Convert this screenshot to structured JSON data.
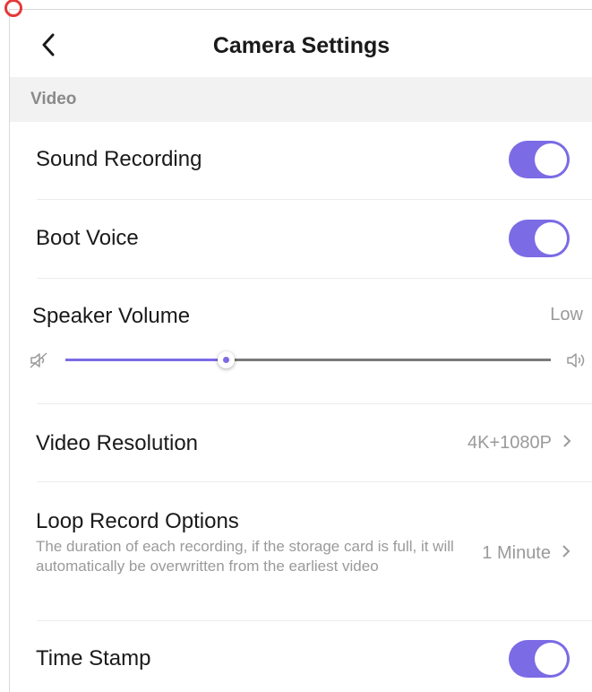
{
  "header": {
    "title": "Camera Settings",
    "back_icon": "chevron-left-icon"
  },
  "section": {
    "label": "Video"
  },
  "rows": {
    "sound_recording": {
      "label": "Sound Recording",
      "enabled": true
    },
    "boot_voice": {
      "label": "Boot Voice",
      "enabled": true
    },
    "speaker_volume": {
      "label": "Speaker Volume",
      "value": "Low",
      "level_fraction": 0.33
    },
    "video_resolution": {
      "label": "Video Resolution",
      "value": "4K+1080P"
    },
    "loop_record": {
      "label": "Loop Record Options",
      "description": "The duration of each recording, if the storage card is full, it will automatically be overwritten from the earliest video",
      "value": "1 Minute"
    },
    "time_stamp": {
      "label": "Time Stamp",
      "enabled": true
    }
  },
  "colors": {
    "accent": "#7b6be5",
    "section_bg": "#f2f2f2",
    "muted_text": "#9a9a9a"
  },
  "icons": {
    "chevron": "chevron-right-icon",
    "volume_low": "speaker-mute-icon",
    "volume_high": "speaker-loud-icon"
  }
}
